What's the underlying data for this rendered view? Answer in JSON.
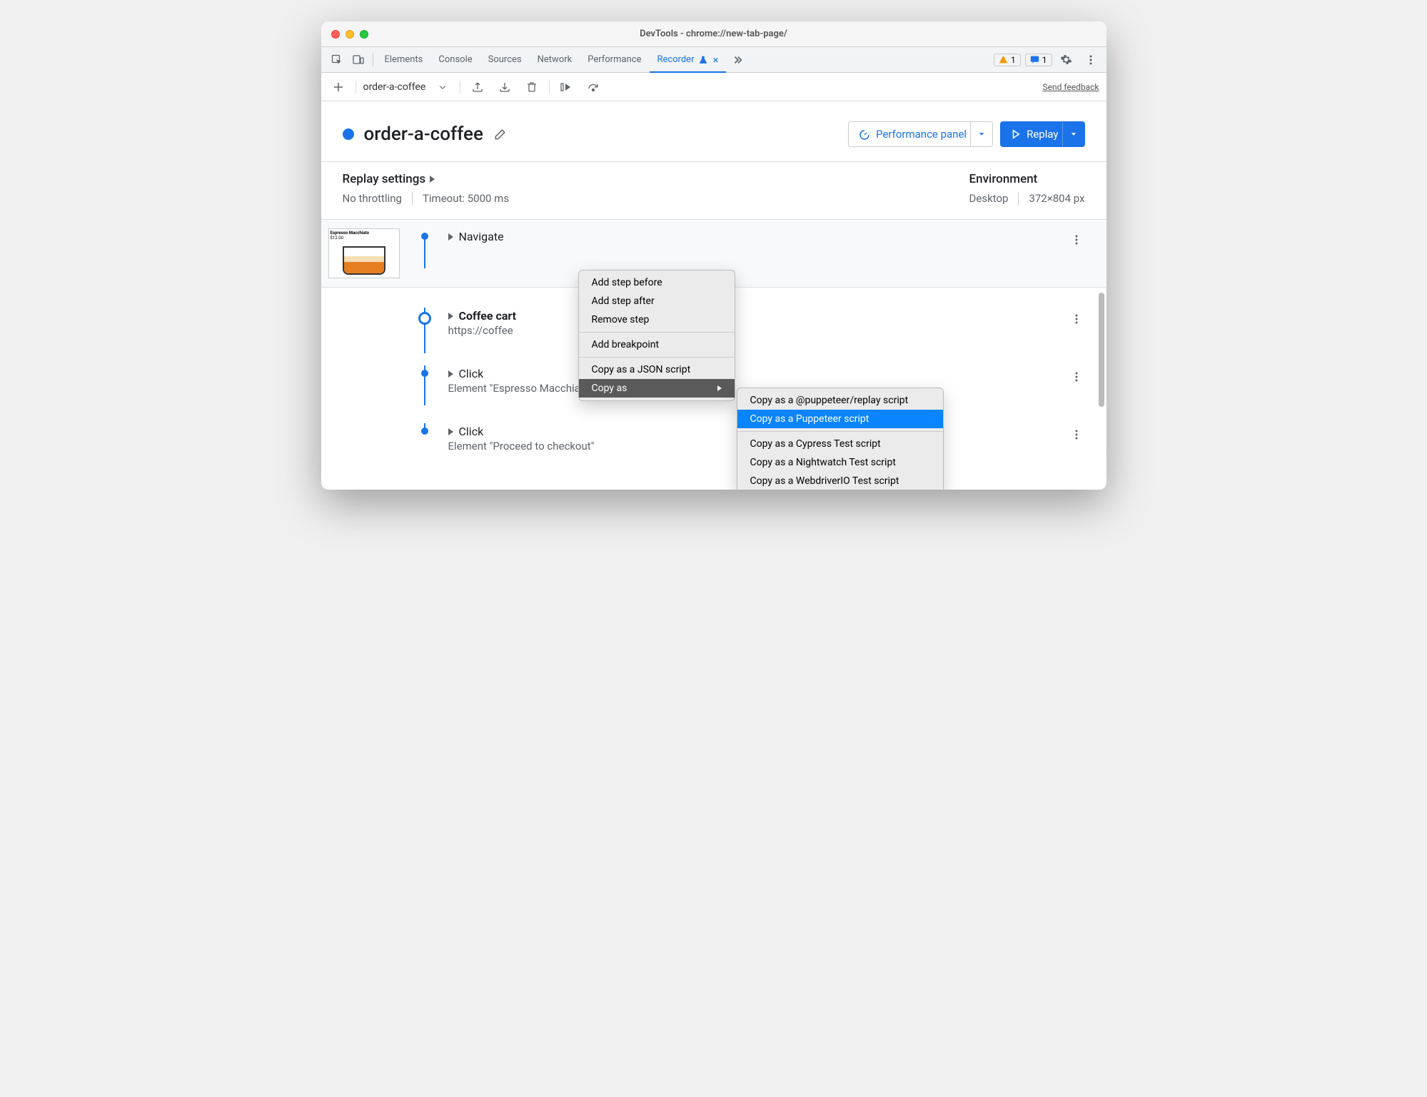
{
  "window_title": "DevTools - chrome://new-tab-page/",
  "tabs": {
    "elements": "Elements",
    "console": "Console",
    "sources": "Sources",
    "network": "Network",
    "performance": "Performance",
    "recorder": "Recorder"
  },
  "badges": {
    "warnings": "1",
    "messages": "1"
  },
  "toolbar": {
    "recording_name": "order-a-coffee",
    "feedback": "Send feedback"
  },
  "recording": {
    "title": "order-a-coffee",
    "perf_button": "Performance panel",
    "replay_button": "Replay"
  },
  "settings": {
    "replay_label": "Replay settings",
    "throttling": "No throttling",
    "timeout": "Timeout: 5000 ms",
    "env_label": "Environment",
    "device": "Desktop",
    "dimensions": "372×804 px"
  },
  "steps": {
    "navigate": "Navigate",
    "coffee_title": "Coffee cart",
    "coffee_sub": "https://coffee",
    "click1_title": "Click",
    "click1_sub": "Element \"Espresso Macchiato\"",
    "click2_title": "Click",
    "click2_sub": "Element \"Proceed to checkout\""
  },
  "context_menu": {
    "add_before": "Add step before",
    "add_after": "Add step after",
    "remove": "Remove step",
    "breakpoint": "Add breakpoint",
    "copy_json": "Copy as a JSON script",
    "copy_as": "Copy as"
  },
  "submenu": {
    "puppeteer_replay": "Copy as a @puppeteer/replay script",
    "puppeteer": "Copy as a Puppeteer script",
    "cypress": "Copy as a Cypress Test script",
    "nightwatch": "Copy as a Nightwatch Test script",
    "webdriverio": "Copy as a WebdriverIO Test script"
  },
  "thumb_label": "Espresso Macchiato",
  "thumb_price": "$12.00"
}
